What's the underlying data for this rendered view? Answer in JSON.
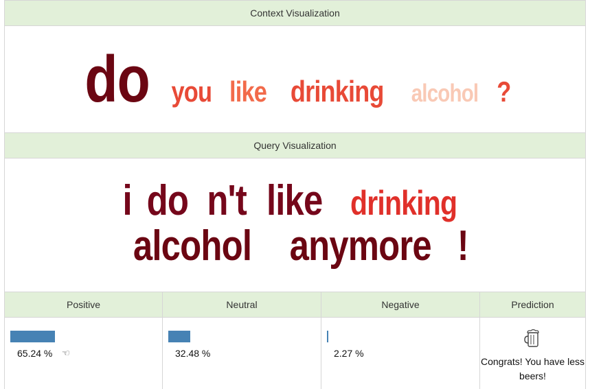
{
  "context": {
    "header": "Context Visualization",
    "words": [
      {
        "text": "do",
        "color": "#6b0612",
        "size": 96
      },
      {
        "text": "you",
        "color": "#e84a37",
        "size": 42
      },
      {
        "text": "like",
        "color": "#f26a4a",
        "size": 42
      },
      {
        "text": "drinking",
        "color": "#e84a37",
        "size": 44
      },
      {
        "text": "alcohol",
        "color": "#f9c9b5",
        "size": 36
      },
      {
        "text": "?",
        "color": "#e84a37",
        "size": 42
      }
    ]
  },
  "query": {
    "header": "Query Visualization",
    "words": [
      {
        "text": "i",
        "color": "#75071b",
        "size": 62
      },
      {
        "text": "do",
        "color": "#75071b",
        "size": 62
      },
      {
        "text": "n't",
        "color": "#75071b",
        "size": 62
      },
      {
        "text": "like",
        "color": "#75071b",
        "size": 62
      },
      {
        "text": "drinking",
        "color": "#e0302a",
        "size": 50
      },
      {
        "text": "alcohol",
        "color": "#6b0612",
        "size": 62
      },
      {
        "text": "anymore",
        "color": "#6b0612",
        "size": 62
      },
      {
        "text": "!",
        "color": "#6b0612",
        "size": 62
      }
    ]
  },
  "results": {
    "headers": {
      "positive": "Positive",
      "neutral": "Neutral",
      "negative": "Negative",
      "prediction": "Prediction"
    },
    "positive": {
      "value": 0.6524,
      "label": "65.24 %",
      "hand": "☜"
    },
    "neutral": {
      "value": 0.3248,
      "label": "32.48 %"
    },
    "negative": {
      "value": 0.0227,
      "label": "2.27 %"
    },
    "bar_color": "#4682b4",
    "prediction": {
      "icon": "beer-mug-icon",
      "text": "Congrats! You have less beers!"
    }
  }
}
